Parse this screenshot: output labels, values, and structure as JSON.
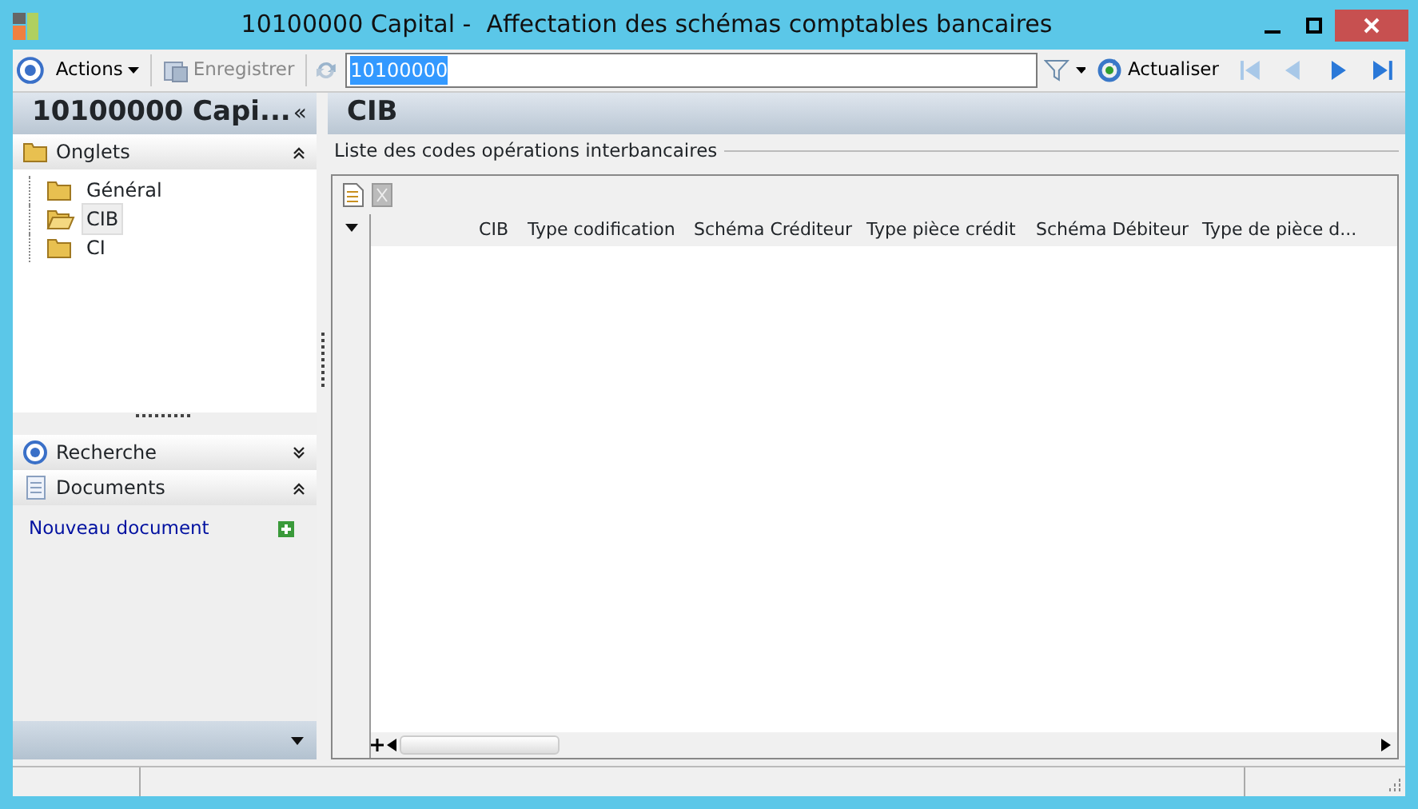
{
  "window": {
    "title": "10100000 Capital -  Affectation des schémas comptables bancaires"
  },
  "toolbar": {
    "actions": "Actions",
    "save": {
      "label": "Enregistrer",
      "disabled": true
    },
    "search": {
      "value": "10100000"
    },
    "refresh": "Actualiser"
  },
  "sidebar": {
    "title": "10100000 Capi...",
    "collapse": "«",
    "tabs": {
      "title": "Onglets",
      "expanded": true,
      "items": [
        {
          "label": "Général",
          "selected": false
        },
        {
          "label": "CIB",
          "selected": true
        },
        {
          "label": "CI",
          "selected": false
        }
      ]
    },
    "sections": [
      {
        "kind": "search",
        "title": "Recherche",
        "expanded": false
      },
      {
        "kind": "documents",
        "title": "Documents",
        "expanded": true,
        "links": [
          "Nouveau document"
        ]
      }
    ]
  },
  "main": {
    "title": "CIB",
    "group_label": "Liste des codes opérations interbancaires",
    "grid": {
      "columns": [
        "CIB",
        "Type codification",
        "Schéma Créditeur",
        "Type pièce crédit",
        "Schéma Débiteur",
        "Type de pièce d..."
      ]
    }
  }
}
